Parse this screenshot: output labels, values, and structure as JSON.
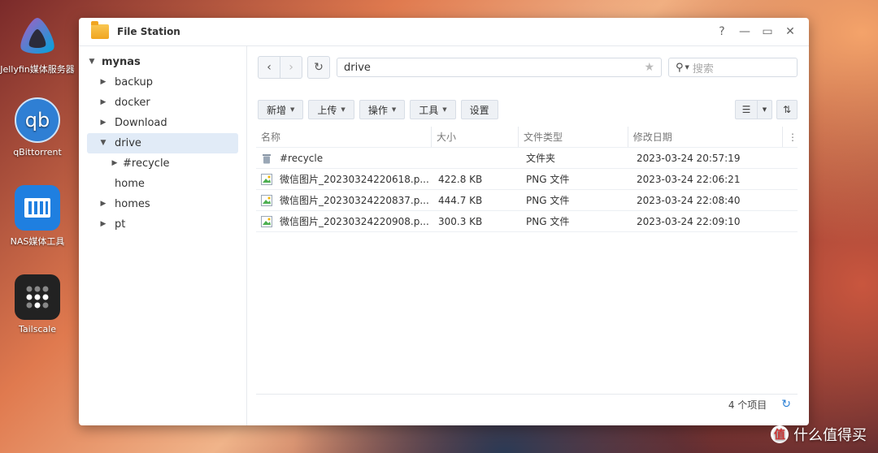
{
  "desktop": {
    "icons": [
      {
        "label": "Jellyfin媒体服务器",
        "icon": "jellyfin-icon"
      },
      {
        "label": "qBittorrent",
        "icon": "qbittorrent-icon"
      },
      {
        "label": "NAS媒体工具",
        "icon": "nas-media-tool-icon"
      },
      {
        "label": "Tailscale",
        "icon": "tailscale-icon"
      }
    ],
    "watermark": "什么值得买",
    "watermark_badge": "值"
  },
  "window": {
    "title": "File Station",
    "controls": {
      "help": "?",
      "minimize": "—",
      "maximize": "▭",
      "close": "✕"
    }
  },
  "sidebar": {
    "root": "mynas",
    "items": [
      {
        "label": "backup"
      },
      {
        "label": "docker"
      },
      {
        "label": "Download"
      },
      {
        "label": "drive"
      },
      {
        "label": "#recycle"
      },
      {
        "label": "home"
      },
      {
        "label": "homes"
      },
      {
        "label": "pt"
      }
    ]
  },
  "navbar": {
    "path": "drive",
    "search_placeholder": "搜索"
  },
  "toolbar": {
    "new": "新增",
    "upload": "上传",
    "action": "操作",
    "tools": "工具",
    "settings": "设置"
  },
  "table": {
    "columns": [
      "名称",
      "大小",
      "文件类型",
      "修改日期"
    ],
    "rows": [
      {
        "name": "#recycle",
        "size": "",
        "type": "文件夹",
        "modified": "2023-03-24 20:57:19",
        "icon": "trash-icon"
      },
      {
        "name": "微信图片_20230324220618.p...",
        "size": "422.8 KB",
        "type": "PNG 文件",
        "modified": "2023-03-24 22:06:21",
        "icon": "image-file-icon"
      },
      {
        "name": "微信图片_20230324220837.p...",
        "size": "444.7 KB",
        "type": "PNG 文件",
        "modified": "2023-03-24 22:08:40",
        "icon": "image-file-icon"
      },
      {
        "name": "微信图片_20230324220908.p...",
        "size": "300.3 KB",
        "type": "PNG 文件",
        "modified": "2023-03-24 22:09:10",
        "icon": "image-file-icon"
      }
    ]
  },
  "status": {
    "count": "4 个项目"
  }
}
